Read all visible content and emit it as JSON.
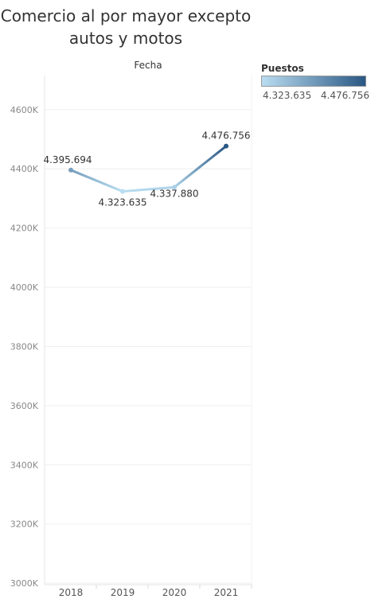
{
  "title": {
    "line1": "Comercio al por mayor excepto",
    "line2": "autos y motos"
  },
  "chart_data": {
    "type": "line",
    "header": "Fecha",
    "categories": [
      "2018",
      "2019",
      "2020",
      "2021"
    ],
    "values": [
      4395694,
      4323635,
      4337880,
      4476756
    ],
    "value_labels": [
      "4.395.694",
      "4.323.635",
      "4.337.880",
      "4.476.756"
    ],
    "ylim": [
      2995000,
      4715000
    ],
    "yticks": [
      3000000,
      3200000,
      3400000,
      3600000,
      3800000,
      4000000,
      4200000,
      4400000,
      4600000
    ],
    "ytick_labels": [
      "3000K",
      "3200K",
      "3400K",
      "3600K",
      "3800K",
      "4000K",
      "4200K",
      "4400K",
      "4600K"
    ],
    "grid": true,
    "color_scale": {
      "low": "#b9ddf1",
      "high": "#2a5783"
    }
  },
  "legend": {
    "title": "Puestos",
    "min_label": "4.323.635",
    "max_label": "4.476.756",
    "placement": "top-right"
  }
}
